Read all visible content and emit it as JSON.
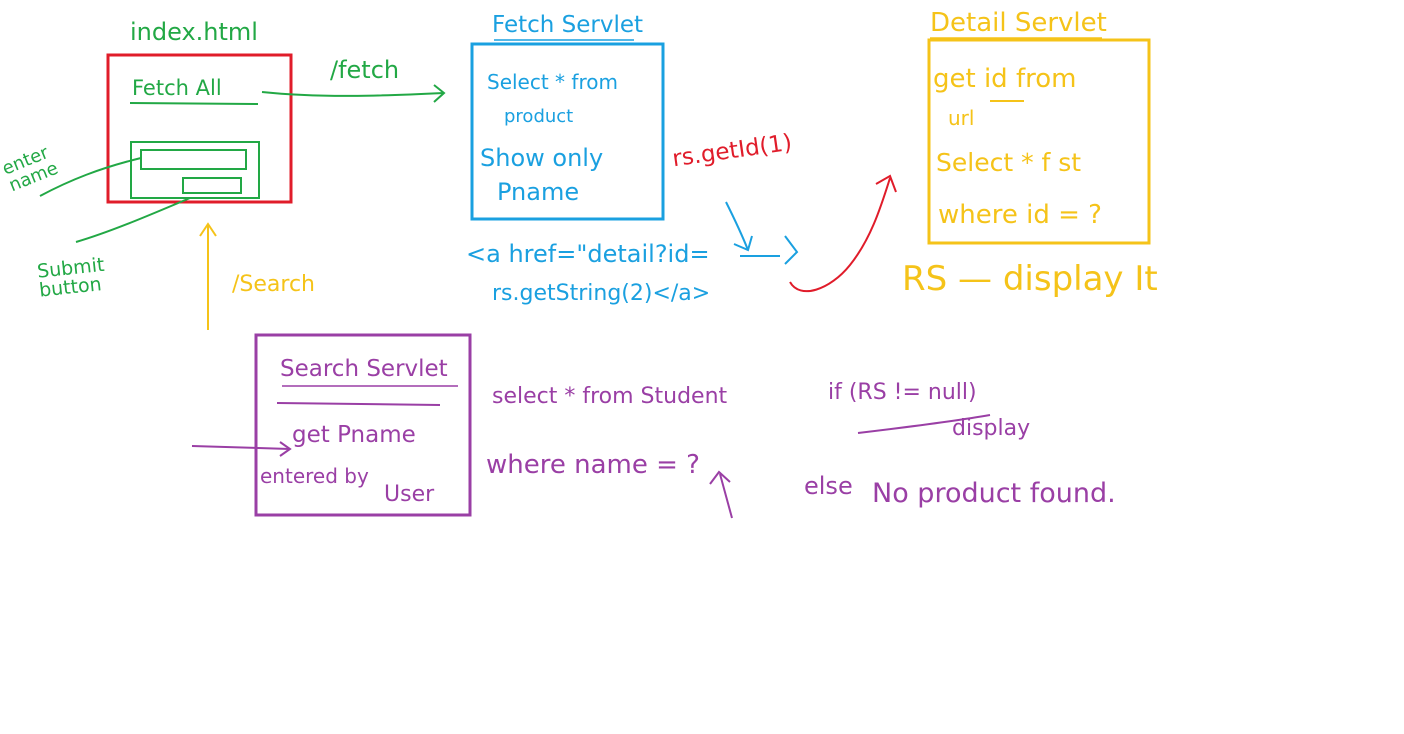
{
  "colors": {
    "green": "#22a845",
    "blue": "#1aa0e0",
    "red": "#e01c2a",
    "yellow": "#f5c319",
    "purple": "#9a3fa5"
  },
  "index": {
    "title": "index.html",
    "fetch_all": "Fetch All",
    "enter_name": "enter name",
    "submit_button": "Submit button"
  },
  "arrows": {
    "fetch": "/fetch",
    "search": "/Search"
  },
  "fetch_servlet": {
    "title": "Fetch Servlet",
    "line1": "Select * from",
    "line2": "product",
    "line3": "Show only",
    "line4": "Pname",
    "rs_getid": "rs.getId(1)",
    "href1": "<a href=\"detail?id=",
    "href2": "rs.getString(2)</a>"
  },
  "detail_servlet": {
    "title": "Detail Servlet",
    "line1": "get id from",
    "line2": "url",
    "line3": "Select * f st",
    "line4": "where id = ?",
    "rs_display": "RS — display It"
  },
  "search_servlet": {
    "title": "Search Servlet",
    "line1": "get Pname",
    "line2": "entered by",
    "line3": "User",
    "query1": "select * from Student",
    "query2": "where name = ?",
    "if_rs": "if (RS != null)",
    "display": "display",
    "else": "else",
    "no_product": "No product found."
  }
}
